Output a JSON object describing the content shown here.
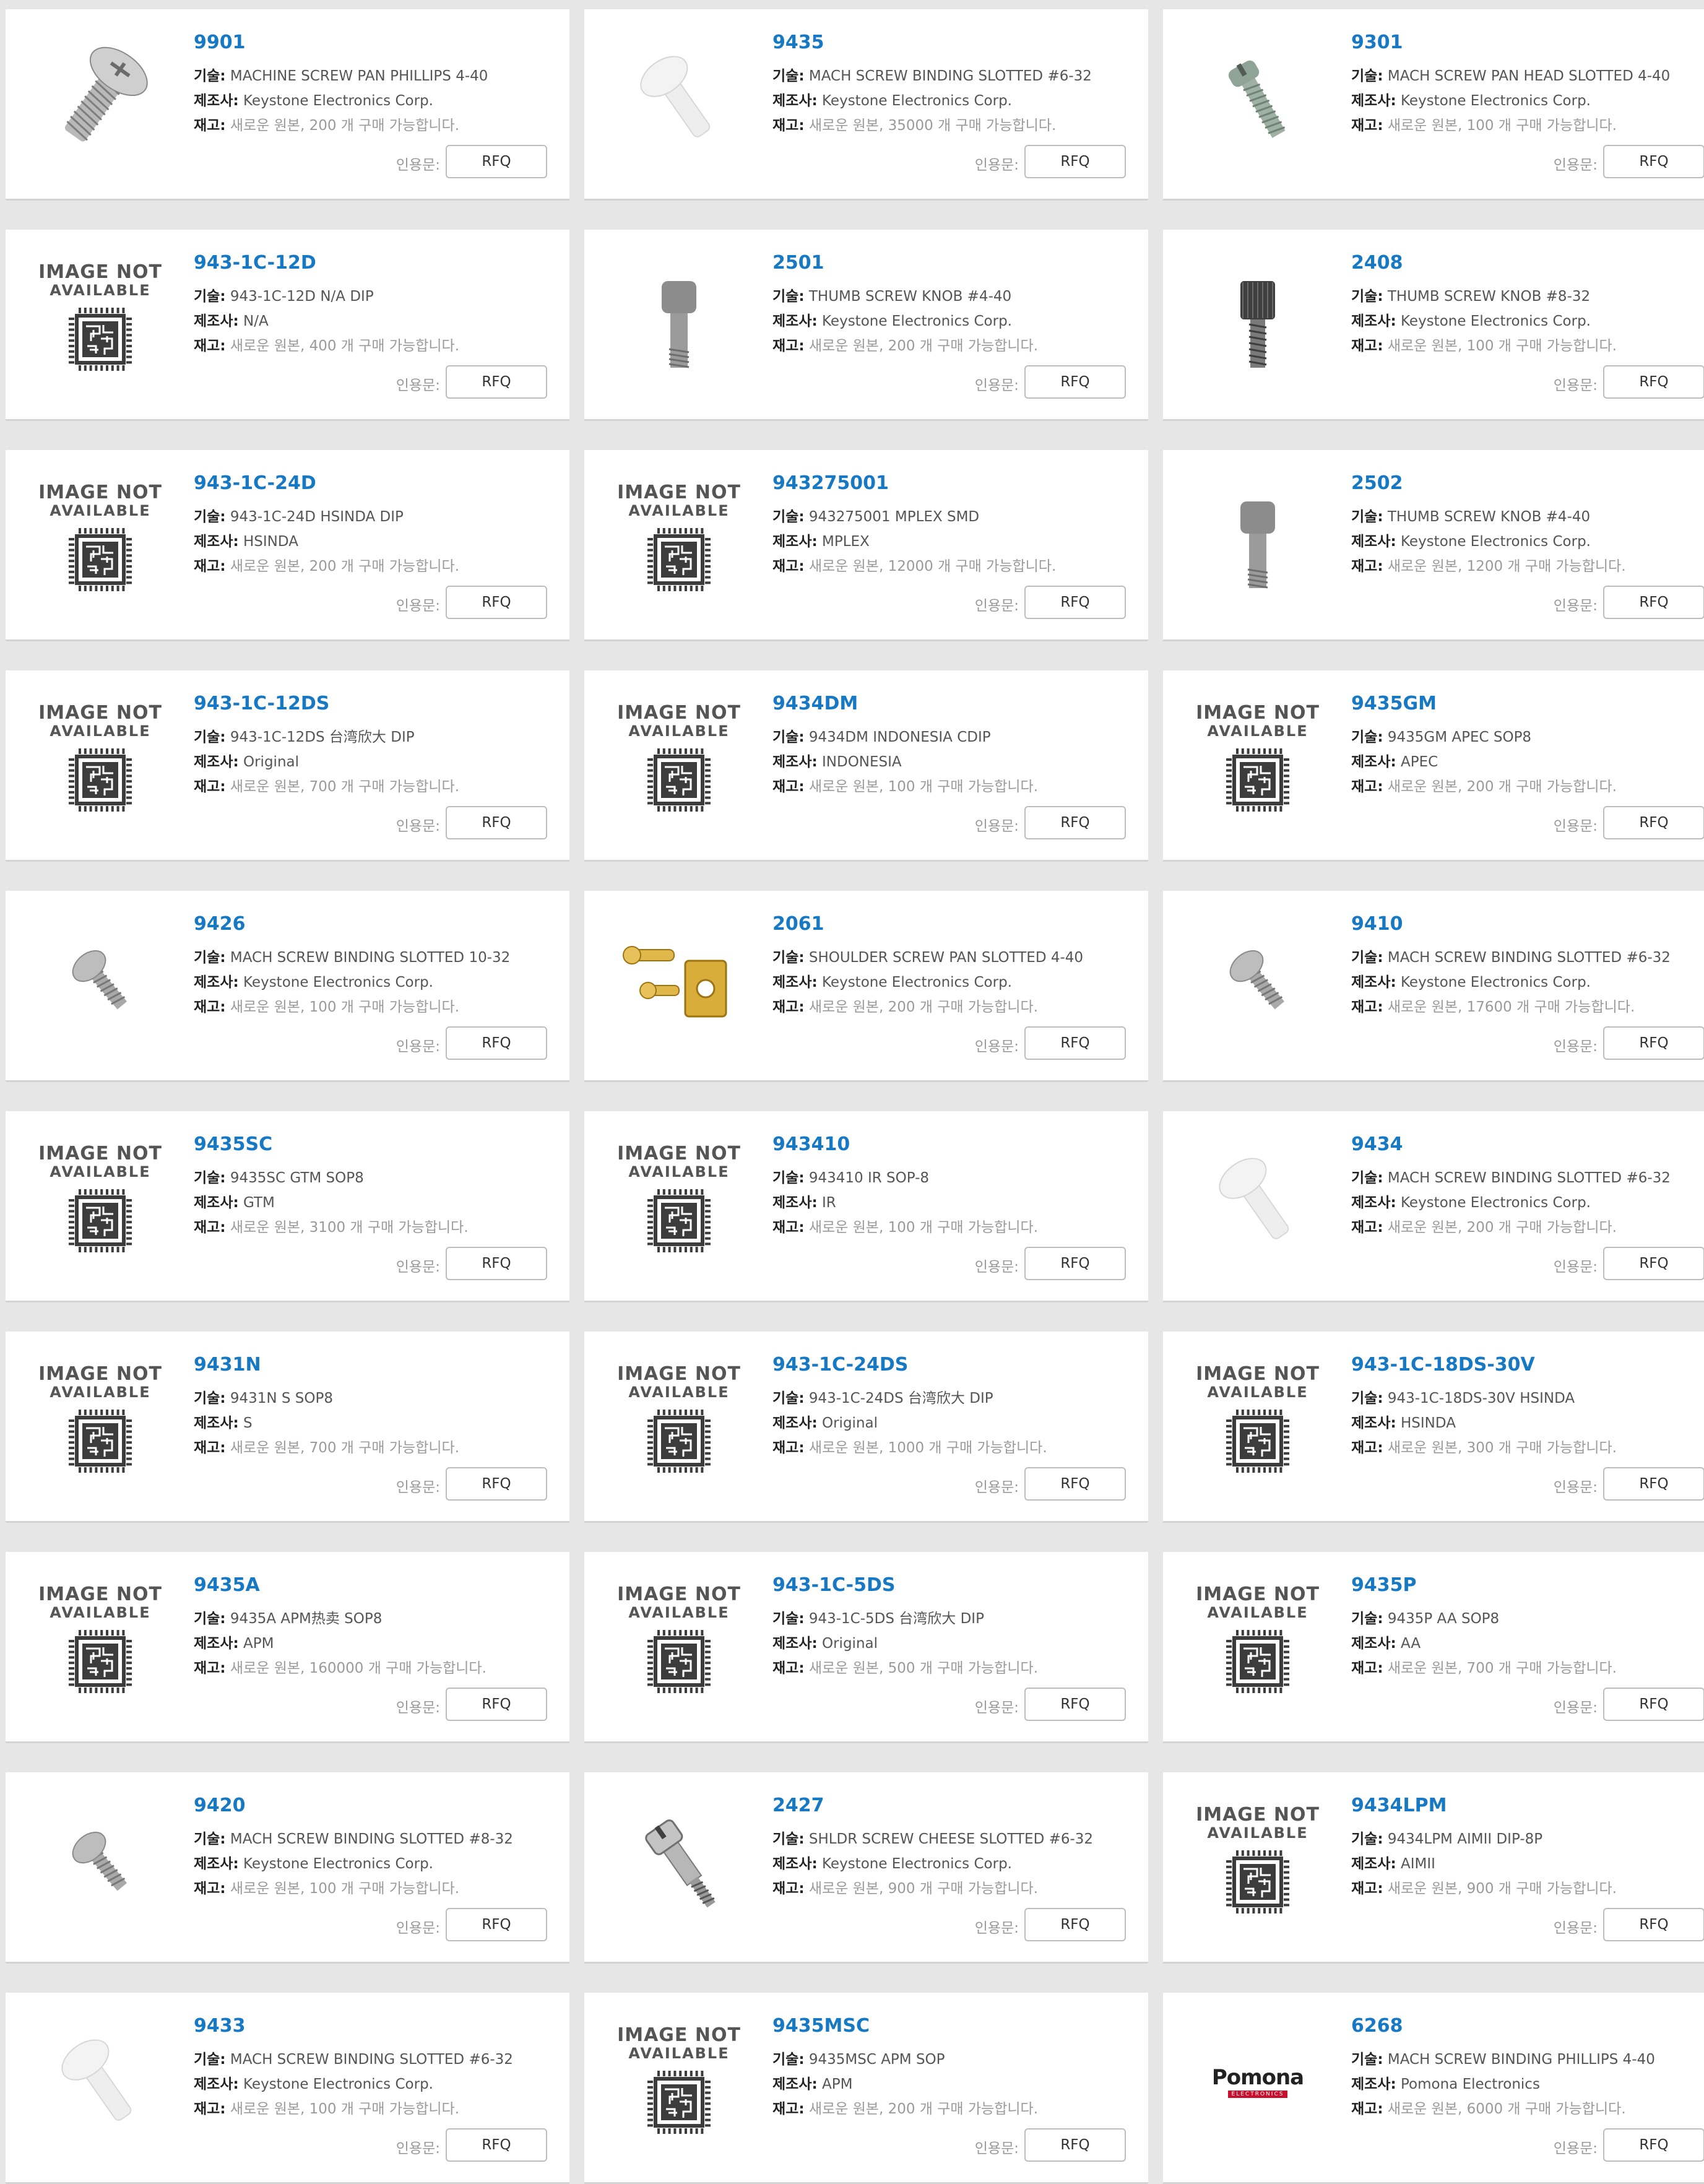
{
  "labels": {
    "tech": "기술:",
    "mfr": "제조사:",
    "stock": "재고:",
    "quote": "인용문:",
    "rfq": "RFQ",
    "na_line1": "IMAGE NOT",
    "na_line2": "AVAILABLE"
  },
  "products": [
    {
      "pn": "9901",
      "tech": "MACHINE SCREW PAN PHILLIPS 4-40",
      "mfr": "Keystone Electronics Corp.",
      "stock": "새로운 원본, 200 개 구매 가능합니다.",
      "image": "screw-pan-phillips-icon"
    },
    {
      "pn": "9435",
      "tech": "MACH SCREW BINDING SLOTTED #6-32",
      "mfr": "Keystone Electronics Corp.",
      "stock": "새로운 원본, 35000 개 구매 가능합니다.",
      "image": "screw-nylon-white-icon"
    },
    {
      "pn": "9301",
      "tech": "MACH SCREW PAN HEAD SLOTTED 4-40",
      "mfr": "Keystone Electronics Corp.",
      "stock": "새로운 원본, 100 개 구매 가능합니다.",
      "image": "screw-slotted-icon"
    },
    {
      "pn": "943-1C-12D",
      "tech": "943-1C-12D N/A DIP",
      "mfr": "N/A",
      "stock": "새로운 원본, 400 개 구매 가능합니다.",
      "image": "image-not-available"
    },
    {
      "pn": "2501",
      "tech": "THUMB SCREW KNOB #4-40",
      "mfr": "Keystone Electronics Corp.",
      "stock": "새로운 원본, 200 개 구매 가능합니다.",
      "image": "thumb-screw-icon"
    },
    {
      "pn": "2408",
      "tech": "THUMB SCREW KNOB #8-32",
      "mfr": "Keystone Electronics Corp.",
      "stock": "새로운 원본, 100 개 구매 가능합니다.",
      "image": "thumb-screw-knurled-icon"
    },
    {
      "pn": "943-1C-24D",
      "tech": "943-1C-24D HSINDA DIP",
      "mfr": "HSINDA",
      "stock": "새로운 원본, 200 개 구매 가능합니다.",
      "image": "image-not-available"
    },
    {
      "pn": "943275001",
      "tech": "943275001 MPLEX SMD",
      "mfr": "MPLEX",
      "stock": "새로운 원본, 12000 개 구매 가능합니다.",
      "image": "image-not-available"
    },
    {
      "pn": "2502",
      "tech": "THUMB SCREW KNOB #4-40",
      "mfr": "Keystone Electronics Corp.",
      "stock": "새로운 원본, 1200 개 구매 가능합니다.",
      "image": "thumb-screw-icon"
    },
    {
      "pn": "943-1C-12DS",
      "tech": "943-1C-12DS 台湾欣大 DIP",
      "mfr": "Original",
      "stock": "새로운 원본, 700 개 구매 가능합니다.",
      "image": "image-not-available"
    },
    {
      "pn": "9434DM",
      "tech": "9434DM INDONESIA CDIP",
      "mfr": "INDONESIA",
      "stock": "새로운 원본, 100 개 구매 가능합니다.",
      "image": "image-not-available"
    },
    {
      "pn": "9435GM",
      "tech": "9435GM APEC SOP8",
      "mfr": "APEC",
      "stock": "새로운 원본, 200 개 구매 가능합니다.",
      "image": "image-not-available"
    },
    {
      "pn": "9426",
      "tech": "MACH SCREW BINDING SLOTTED 10-32",
      "mfr": "Keystone Electronics Corp.",
      "stock": "새로운 원본, 100 개 구매 가능합니다.",
      "image": "screw-small-icon"
    },
    {
      "pn": "2061",
      "tech": "SHOULDER SCREW PAN SLOTTED 4-40",
      "mfr": "Keystone Electronics Corp.",
      "stock": "새로운 원본, 200 개 구매 가능합니다.",
      "image": "brass-hardware-icon"
    },
    {
      "pn": "9410",
      "tech": "MACH SCREW BINDING SLOTTED #6-32",
      "mfr": "Keystone Electronics Corp.",
      "stock": "새로운 원본, 17600 개 구매 가능합니다.",
      "image": "screw-small-icon"
    },
    {
      "pn": "9435SC",
      "tech": "9435SC GTM SOP8",
      "mfr": "GTM",
      "stock": "새로운 원본, 3100 개 구매 가능합니다.",
      "image": "image-not-available"
    },
    {
      "pn": "943410",
      "tech": "943410 IR SOP-8",
      "mfr": "IR",
      "stock": "새로운 원본, 100 개 구매 가능합니다.",
      "image": "image-not-available"
    },
    {
      "pn": "9434",
      "tech": "MACH SCREW BINDING SLOTTED #6-32",
      "mfr": "Keystone Electronics Corp.",
      "stock": "새로운 원본, 200 개 구매 가능합니다.",
      "image": "screw-nylon-white-icon"
    },
    {
      "pn": "9431N",
      "tech": "9431N S SOP8",
      "mfr": "S",
      "stock": "새로운 원본, 700 개 구매 가능합니다.",
      "image": "image-not-available"
    },
    {
      "pn": "943-1C-24DS",
      "tech": "943-1C-24DS 台湾欣大 DIP",
      "mfr": "Original",
      "stock": "새로운 원본, 1000 개 구매 가능합니다.",
      "image": "image-not-available"
    },
    {
      "pn": "943-1C-18DS-30V",
      "tech": "943-1C-18DS-30V HSINDA",
      "mfr": "HSINDA",
      "stock": "새로운 원본, 300 개 구매 가능합니다.",
      "image": "image-not-available"
    },
    {
      "pn": "9435A",
      "tech": "9435A APM热卖 SOP8",
      "mfr": "APM",
      "stock": "새로운 원본, 160000 개 구매 가능합니다.",
      "image": "image-not-available"
    },
    {
      "pn": "943-1C-5DS",
      "tech": "943-1C-5DS 台湾欣大 DIP",
      "mfr": "Original",
      "stock": "새로운 원본, 500 개 구매 가능합니다.",
      "image": "image-not-available"
    },
    {
      "pn": "9435P",
      "tech": "9435P AA SOP8",
      "mfr": "AA",
      "stock": "새로운 원본, 700 개 구매 가능합니다.",
      "image": "image-not-available"
    },
    {
      "pn": "9420",
      "tech": "MACH SCREW BINDING SLOTTED #8-32",
      "mfr": "Keystone Electronics Corp.",
      "stock": "새로운 원본, 100 개 구매 가능합니다.",
      "image": "screw-small-icon"
    },
    {
      "pn": "2427",
      "tech": "SHLDR SCREW CHEESE SLOTTED #6-32",
      "mfr": "Keystone Electronics Corp.",
      "stock": "새로운 원본, 900 개 구매 가능합니다.",
      "image": "shoulder-screw-icon"
    },
    {
      "pn": "9434LPM",
      "tech": "9434LPM AIMII DIP-8P",
      "mfr": "AIMII",
      "stock": "새로운 원본, 900 개 구매 가능합니다.",
      "image": "image-not-available"
    },
    {
      "pn": "9433",
      "tech": "MACH SCREW BINDING SLOTTED #6-32",
      "mfr": "Keystone Electronics Corp.",
      "stock": "새로운 원본, 100 개 구매 가능합니다.",
      "image": "screw-nylon-white-icon"
    },
    {
      "pn": "9435MSC",
      "tech": "9435MSC APM SOP",
      "mfr": "APM",
      "stock": "새로운 원본, 200 개 구매 가능합니다.",
      "image": "image-not-available"
    },
    {
      "pn": "6268",
      "tech": "MACH SCREW BINDING PHILLIPS 4-40",
      "mfr": "Pomona Electronics",
      "stock": "새로운 원본, 6000 개 구매 가능합니다.",
      "image": "pomona-logo",
      "logo_text": "Pomona",
      "logo_sub": "ELECTRONICS"
    }
  ],
  "colors": {
    "accent": "#1779c4",
    "page_bg": "#e6e6e6",
    "muted": "#9a9a9a"
  }
}
